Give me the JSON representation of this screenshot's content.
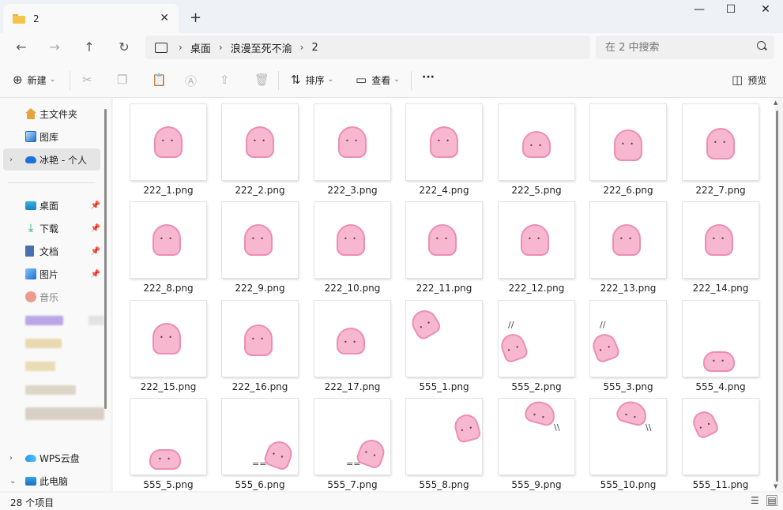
{
  "tab": {
    "title": "2",
    "close": "✕",
    "new": "+"
  },
  "window": {
    "minimize": "—",
    "maximize": "☐",
    "close": "✕"
  },
  "nav": {
    "back": "←",
    "forward": "→",
    "up": "↑",
    "refresh": "↻"
  },
  "breadcrumb": {
    "items": [
      "桌面",
      "浪漫至死不渝",
      "2"
    ],
    "sep": "›"
  },
  "search": {
    "placeholder": "在 2 中搜索"
  },
  "toolbar": {
    "new_label": "新建",
    "sort_label": "排序",
    "view_label": "查看",
    "more_label": "···",
    "preview_label": "预览"
  },
  "sidebar": {
    "items": [
      {
        "label": "主文件夹",
        "icon": "home-icon"
      },
      {
        "label": "图库",
        "icon": "gallery-icon"
      },
      {
        "label": "冰艳 - 个人",
        "icon": "cloud-icon"
      },
      {
        "label": "桌面",
        "icon": "desktop-icon"
      },
      {
        "label": "下载",
        "icon": "download-icon"
      },
      {
        "label": "文档",
        "icon": "document-icon"
      },
      {
        "label": "图片",
        "icon": "pictures-icon"
      },
      {
        "label": "音乐",
        "icon": "music-icon"
      },
      {
        "label": "WPS云盘",
        "icon": "wps-cloud-icon"
      },
      {
        "label": "此电脑",
        "icon": "this-pc-icon"
      }
    ]
  },
  "files": [
    "222_1.png",
    "222_2.png",
    "222_3.png",
    "222_4.png",
    "222_5.png",
    "222_6.png",
    "222_7.png",
    "222_8.png",
    "222_9.png",
    "222_10.png",
    "222_11.png",
    "222_12.png",
    "222_13.png",
    "222_14.png",
    "222_15.png",
    "222_16.png",
    "222_17.png",
    "555_1.png",
    "555_2.png",
    "555_3.png",
    "555_4.png",
    "555_5.png",
    "555_6.png",
    "555_7.png",
    "555_8.png",
    "555_9.png",
    "555_10.png",
    "555_11.png"
  ],
  "status": {
    "count": "28 个项目"
  },
  "colors": {
    "accent": "#1a73d9",
    "ghost_fill": "#f7b7cf",
    "ghost_stroke": "#ee8db3"
  }
}
